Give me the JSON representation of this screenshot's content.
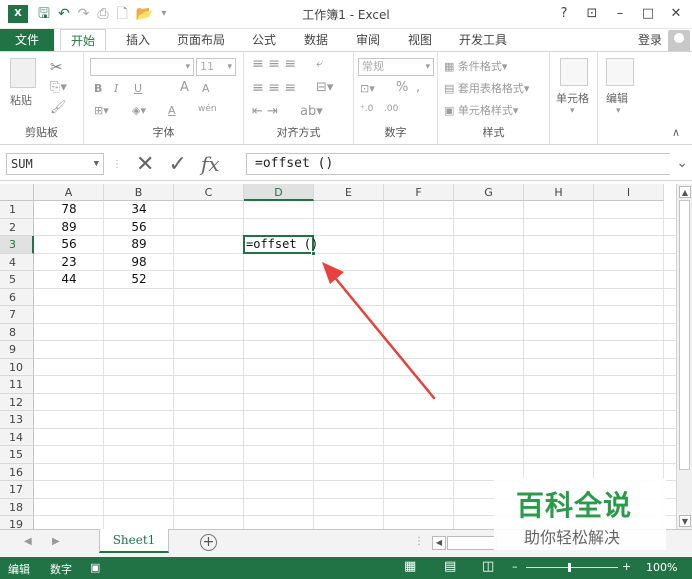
{
  "app": {
    "logo": "X",
    "title": "工作簿1 - Excel",
    "window_controls": [
      "?",
      "⊡",
      "–",
      "□",
      "✕"
    ]
  },
  "qat": {
    "save_icon": "save-icon",
    "undo_icon": "undo-icon",
    "redo_icon": "redo-icon"
  },
  "tabs": [
    "文件",
    "开始",
    "插入",
    "页面布局",
    "公式",
    "数据",
    "审阅",
    "视图",
    "开发工具"
  ],
  "active_tab": "开始",
  "login_label": "登录",
  "ribbon": {
    "clipboard": {
      "label": "剪贴板",
      "paste": "粘贴"
    },
    "font": {
      "label": "字体",
      "size": "11",
      "bold": "B",
      "italic": "I",
      "underline": "U",
      "grow": "A",
      "shrink": "A",
      "color": "A",
      "phonetic": "wén"
    },
    "alignment": {
      "label": "对齐方式"
    },
    "number": {
      "label": "数字",
      "format": "常规",
      "percent": "%",
      "comma": ","
    },
    "styles": {
      "label": "样式",
      "cond_format": "条件格式",
      "table_format": "套用表格格式",
      "cell_style": "单元格样式"
    },
    "cells": {
      "label": "单元格"
    },
    "editing": {
      "label": "编辑"
    }
  },
  "formula_bar": {
    "name_box": "SUM",
    "cancel": "✕",
    "enter": "✓",
    "fx": "fx",
    "formula": "=offset ()"
  },
  "sheet": {
    "columns": [
      "A",
      "B",
      "C",
      "D",
      "E",
      "F",
      "G",
      "H",
      "I"
    ],
    "rows": [
      "1",
      "2",
      "3",
      "4",
      "5",
      "6",
      "7",
      "8",
      "9",
      "10",
      "11",
      "12",
      "13",
      "14",
      "15",
      "16",
      "17",
      "18",
      "19"
    ],
    "selected_column": "D",
    "selected_row": "3",
    "cells": {
      "A1": "78",
      "B1": "34",
      "A2": "89",
      "B2": "56",
      "A3": "56",
      "B3": "89",
      "A4": "23",
      "B4": "98",
      "A5": "44",
      "B5": "52"
    },
    "active_cell_text": "=offset ()"
  },
  "sheet_tabs": {
    "tabs": [
      "Sheet1"
    ],
    "add": "+"
  },
  "status": {
    "mode": "编辑",
    "num_lock": "数字",
    "zoom": "100%"
  },
  "watermark": {
    "title": "百科全说",
    "subtitle": "助你轻松解决"
  },
  "colors": {
    "accent": "#217346",
    "arrow": "#e8403a",
    "watermark": "#2b9a4a"
  }
}
